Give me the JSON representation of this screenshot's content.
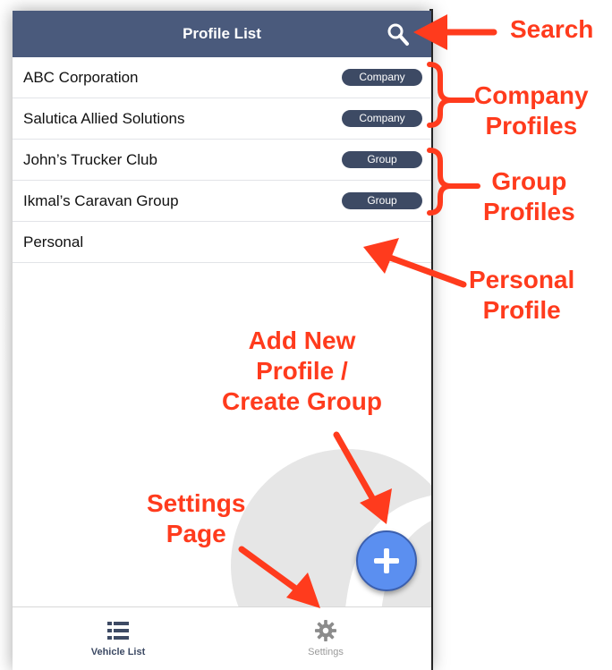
{
  "header": {
    "title": "Profile List",
    "search_icon": "search-icon"
  },
  "profiles": [
    {
      "name": "ABC Corporation",
      "badge": "Company"
    },
    {
      "name": "Salutica Allied Solutions",
      "badge": "Company"
    },
    {
      "name": "John’s Trucker Club",
      "badge": "Group"
    },
    {
      "name": "Ikmal’s Caravan Group",
      "badge": "Group"
    },
    {
      "name": "Personal",
      "badge": null
    }
  ],
  "fab": {
    "icon": "plus-icon"
  },
  "tabbar": {
    "vehicle_list": {
      "label": "Vehicle List",
      "icon": "list-icon"
    },
    "settings": {
      "label": "Settings",
      "icon": "gear-icon"
    }
  },
  "annotations": {
    "search": "Search",
    "company_profiles": [
      "Company",
      "Profiles"
    ],
    "group_profiles": [
      "Group",
      "Profiles"
    ],
    "personal_profile": [
      "Personal",
      "Profile"
    ],
    "add_new_profile": [
      "Add New",
      "Profile /",
      "Create Group"
    ],
    "settings_page": [
      "Settings",
      "Page"
    ]
  },
  "colors": {
    "navbar": "#4a5a7c",
    "badge": "#3d4a64",
    "fab": "#5b8ff0",
    "annotation": "#ff3b1d"
  }
}
